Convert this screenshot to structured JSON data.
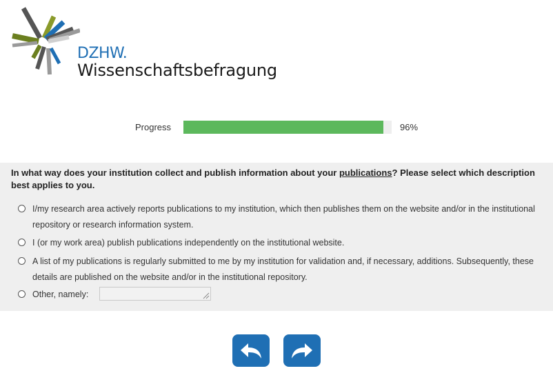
{
  "logo": {
    "abbreviation": "DZHW.",
    "name": "Wissenschaftsbefragung",
    "colors": [
      "#6b7f1f",
      "#8a9a2a",
      "#555555",
      "#9a9a9a",
      "#cfcfcf",
      "#1f6fb4"
    ]
  },
  "progress": {
    "label": "Progress",
    "value_text": "96%",
    "fraction": 0.96,
    "fill_color": "#5cb85c"
  },
  "question": {
    "text_before": "In what way does your institution collect and publish information about your ",
    "text_link": "publications",
    "text_after": "? Please select which description best applies to you.",
    "options": [
      {
        "label": "I/my research area actively reports publications to my institution, which then publishes them on the website and/or in the institutional repository or research information system."
      },
      {
        "label": "I (or my work area) publish publications independently on the institutional website."
      },
      {
        "label": "A list of my publications is regularly submitted to me by my institution for validation and, if necessary, additions. Subsequently, these details are published on the website and/or in the institutional repository."
      },
      {
        "label": "Other, namely:"
      }
    ],
    "other_value": ""
  },
  "navigation": {
    "back_icon": "undo-arrow-icon",
    "next_icon": "redo-arrow-icon",
    "button_color": "#1f6fb4"
  }
}
